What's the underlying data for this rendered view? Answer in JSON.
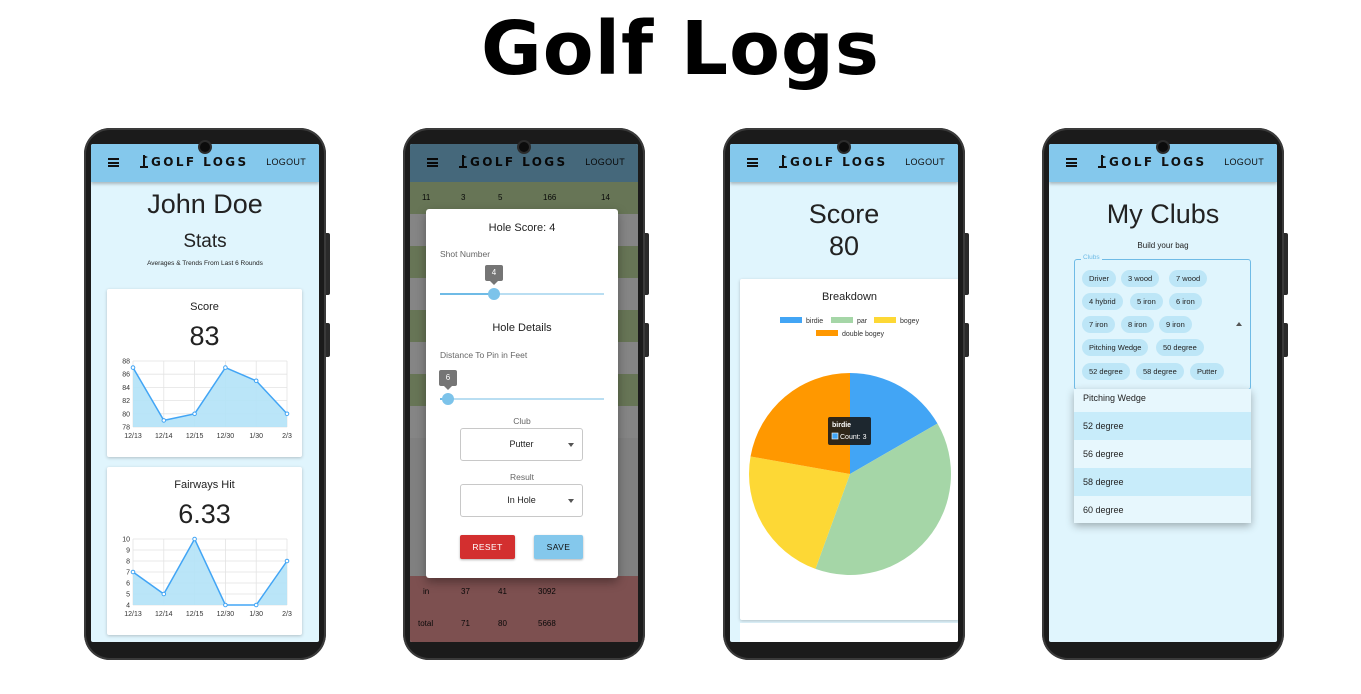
{
  "page_title": "Golf Logs",
  "app": {
    "brand": "GOLF LOGS",
    "logout": "LOGOUT"
  },
  "stats_screen": {
    "user_name": "John Doe",
    "heading": "Stats",
    "subheading": "Averages & Trends From Last 6 Rounds",
    "score_card": {
      "title": "Score",
      "value": "83",
      "y_ticks": [
        "88",
        "86",
        "84",
        "82",
        "80",
        "78"
      ],
      "x_ticks": [
        "12/13",
        "12/14",
        "12/15",
        "12/30",
        "1/30",
        "2/3"
      ]
    },
    "fairways_card": {
      "title": "Fairways Hit",
      "value": "6.33",
      "y_ticks": [
        "10",
        "9",
        "8",
        "7",
        "6",
        "5",
        "4"
      ],
      "x_ticks": [
        "12/13",
        "12/14",
        "12/15",
        "12/30",
        "1/30",
        "2/3"
      ]
    }
  },
  "hole_screen": {
    "table_top_row": [
      "11",
      "3",
      "5",
      "166",
      "14"
    ],
    "table_bottom_rows": [
      [
        "in",
        "37",
        "41",
        "3092"
      ],
      [
        "total",
        "71",
        "80",
        "5668"
      ]
    ],
    "dialog": {
      "title": "Hole Score: 4",
      "shot_label": "Shot Number",
      "shot_value": "4",
      "details_title": "Hole Details",
      "distance_label": "Distance To Pin in Feet",
      "distance_value": "6",
      "club_label": "Club",
      "club_value": "Putter",
      "result_label": "Result",
      "result_value": "In Hole",
      "reset_label": "RESET",
      "save_label": "SAVE"
    }
  },
  "score_screen": {
    "title": "Score",
    "value": "80",
    "breakdown_title": "Breakdown",
    "legend": [
      {
        "label": "birdie",
        "color": "#42a5f5"
      },
      {
        "label": "par",
        "color": "#a5d6a7"
      },
      {
        "label": "bogey",
        "color": "#fdd835"
      },
      {
        "label": "double bogey",
        "color": "#ff9800"
      }
    ],
    "tooltip": {
      "title": "birdie",
      "body": "Count: 3"
    }
  },
  "clubs_screen": {
    "title": "My Clubs",
    "subtitle": "Build your bag",
    "field_label": "Clubs",
    "chips": [
      "Driver",
      "3 wood",
      "7 wood",
      "4 hybrid",
      "5 iron",
      "6 iron",
      "7 iron",
      "8 iron",
      "9 iron",
      "Pitching Wedge",
      "50 degree",
      "52 degree",
      "58 degree",
      "Putter"
    ],
    "dropdown_options": [
      "Pitching Wedge",
      "52 degree",
      "56 degree",
      "58 degree",
      "60 degree"
    ]
  },
  "chart_data": [
    {
      "type": "area",
      "title": "Score",
      "x": [
        "12/13",
        "12/14",
        "12/15",
        "12/30",
        "1/30",
        "2/3"
      ],
      "series": [
        {
          "values": [
            87,
            79,
            80,
            87,
            85,
            80
          ]
        }
      ],
      "ylim": [
        78,
        88
      ],
      "grid": true
    },
    {
      "type": "area",
      "title": "Fairways Hit",
      "x": [
        "12/13",
        "12/14",
        "12/15",
        "12/30",
        "1/30",
        "2/3"
      ],
      "series": [
        {
          "values": [
            7,
            5,
            10,
            4,
            4,
            8
          ]
        }
      ],
      "ylim": [
        4,
        10
      ],
      "grid": true
    },
    {
      "type": "pie",
      "title": "Breakdown",
      "categories": [
        "birdie",
        "par",
        "bogey",
        "double bogey"
      ],
      "values": [
        3,
        7,
        4,
        4
      ],
      "colors": [
        "#42a5f5",
        "#a5d6a7",
        "#fdd835",
        "#ff9800"
      ],
      "legend": "top"
    }
  ]
}
